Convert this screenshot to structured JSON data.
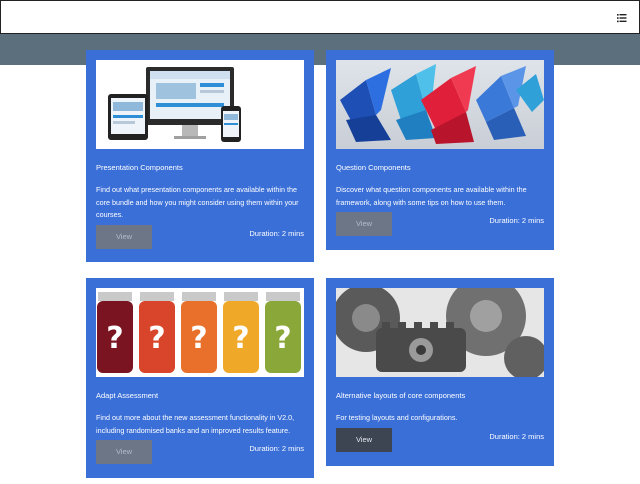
{
  "navbar": {
    "menu_icon": "list-menu-icon"
  },
  "cards": [
    {
      "title": "Presentation Components",
      "body": "Find out what presentation components are available within the core bundle and how you might consider using them within your courses.",
      "view_label": "View",
      "duration": "Duration: 2 mins",
      "image_icon": "devices-image"
    },
    {
      "title": "Question Components",
      "body": "Discover what question components are available within the framework, along with some tips on how to use them.",
      "view_label": "View",
      "duration": "Duration: 2 mins",
      "image_icon": "paper-cranes-image"
    },
    {
      "title": "Adapt Assessment",
      "body": "Find out more about the new assessment functionality in V2.0, including randomised banks and an improved results feature.",
      "view_label": "View",
      "duration": "Duration: 2 mins",
      "image_icon": "question-jars-image"
    },
    {
      "title": "Alternative layouts of core components",
      "body": "For testing layouts and configurations.",
      "view_label": "View",
      "duration": "Duration: 2 mins",
      "image_icon": "gears-image"
    }
  ],
  "colors": {
    "card_bg": "#3a6fd8",
    "band": "#5c6f7c",
    "view_disabled": "#6c7686",
    "view_enabled": "#3d4552"
  }
}
